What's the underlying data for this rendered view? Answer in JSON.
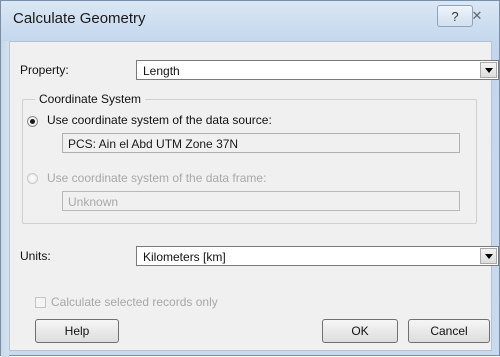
{
  "window": {
    "title": "Calculate Geometry",
    "help_icon": "question-mark-icon",
    "close_icon": "close-icon",
    "help_glyph": "?",
    "close_glyph": "✕"
  },
  "property": {
    "label": "Property:",
    "value": "Length"
  },
  "coordinate_system": {
    "title": "Coordinate System",
    "option_source": {
      "label": "Use coordinate system of the data source:",
      "selected": true,
      "value": "PCS: Ain el Abd UTM Zone 37N"
    },
    "option_frame": {
      "label": "Use coordinate system of the data frame:",
      "selected": false,
      "enabled": false,
      "value": "Unknown"
    }
  },
  "units": {
    "label": "Units:",
    "value": "Kilometers [km]"
  },
  "selected_only": {
    "label": "Calculate selected records only",
    "checked": false,
    "enabled": false
  },
  "buttons": {
    "help": "Help",
    "ok": "OK",
    "cancel": "Cancel"
  },
  "colors": {
    "title_bar": "#c4d7ed",
    "dialog_bg": "#f0f0f0",
    "disabled_text": "#a8a8a8"
  }
}
